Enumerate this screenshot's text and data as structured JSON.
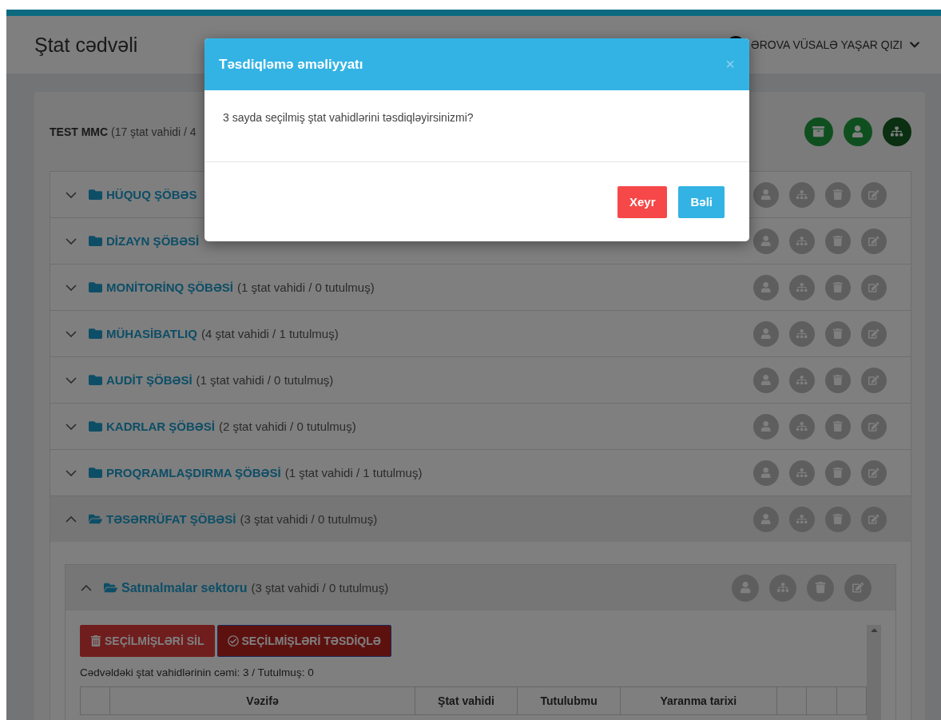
{
  "page": {
    "title": "Ştat cədvəli",
    "user": {
      "name": "ƏROVA VÜSALƏ YAŞAR QIZI"
    }
  },
  "organization": {
    "name": "TEST MMC",
    "summary": "(17 ştat vahidi / 4"
  },
  "departments": [
    {
      "name": "HÜQUQ ŞÖBƏS",
      "expanded": false
    },
    {
      "name": "DİZAYN ŞÖBƏSİ",
      "expanded": false
    },
    {
      "name": "MONİTORİNQ ŞÖBƏSİ",
      "summary": "(1 ştat vahidi / 0 tutulmuş)",
      "expanded": false
    },
    {
      "name": "MÜHASİBATLIQ",
      "summary": "(4 ştat vahidi / 1 tutulmuş)",
      "expanded": false
    },
    {
      "name": "AUDİT ŞÖBƏSİ",
      "summary": "(1 ştat vahidi / 0 tutulmuş)",
      "expanded": false
    },
    {
      "name": "KADRLAR ŞÖBƏSİ",
      "summary": "(2 ştat vahidi / 0 tutulmuş)",
      "expanded": false
    },
    {
      "name": "PROQRAMLAŞDIRMA ŞÖBƏSİ",
      "summary": "(1 ştat vahidi / 1 tutulmuş)",
      "expanded": false
    },
    {
      "name": "TƏSƏRRÜFAT ŞÖBƏSİ",
      "summary": "(3 ştat vahidi / 0 tutulmuş)",
      "expanded": true,
      "children": [
        {
          "name": "Satınalmalar sektoru",
          "summary": "(3 ştat vahidi / 0 tutulmuş)",
          "expanded": true,
          "buttons": [
            {
              "label": "SEÇİLMİŞLƏRİ SİL",
              "kind": "delete"
            },
            {
              "label": "SEÇİLMİŞLƏRİ TƏSDİQLƏ",
              "kind": "approve"
            }
          ],
          "total_text": "Cədvəldəki ştat vahidlərinin cəmi: 3 / Tutulmuş: 0",
          "table": {
            "columns": [
              "",
              "Vəzifə",
              "Ştat vahidi",
              "Tutulubmu",
              "Yaranma tarixi",
              "",
              "",
              ""
            ]
          }
        }
      ]
    }
  ],
  "modal": {
    "title": "Təsdiqləmə əməliyyatı",
    "close": "×",
    "message": "3 sayda seçilmiş ştat vahidlərini təsdiqləyirsinizmi?",
    "buttons": [
      {
        "label": "Xeyr",
        "kind": "cancel"
      },
      {
        "label": "Bəli",
        "kind": "confirm"
      }
    ]
  }
}
